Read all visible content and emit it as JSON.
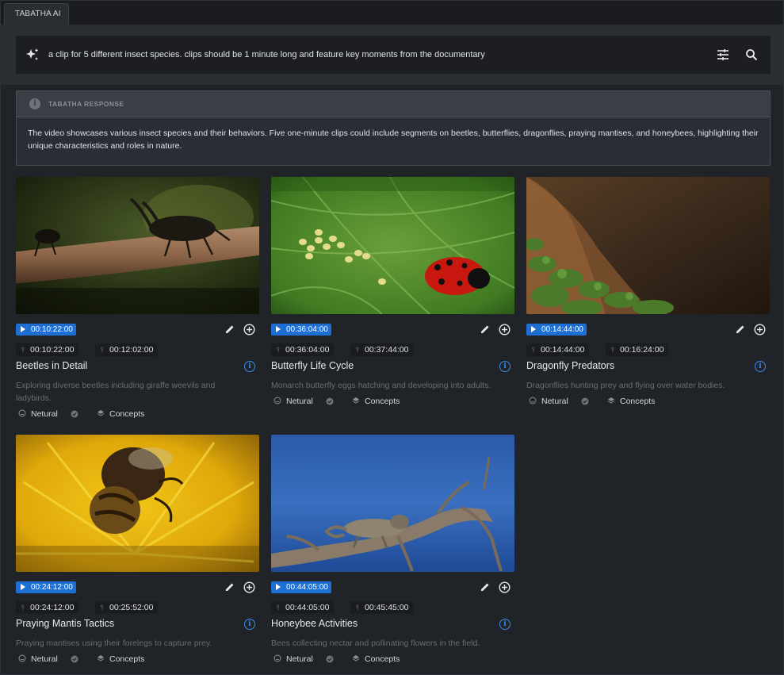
{
  "tab": {
    "label": "TABATHA AI"
  },
  "search": {
    "query": "a clip for 5 different insect species. clips should be 1 minute long and feature key moments from the documentary"
  },
  "response": {
    "title": "TABATHA RESPONSE",
    "body": "The video showcases various insect species and their behaviors. Five one-minute clips could include segments on beetles, butterflies, dragonflies, praying mantises, and honeybees, highlighting their unique characteristics and roles in nature."
  },
  "colors": {
    "accent": "#1e6fd4",
    "info": "#3b8be8",
    "background": "#202327"
  },
  "clips": [
    {
      "start": "00:10:22:00",
      "in": "00:10:22:00",
      "out": "00:12:02:00",
      "title": "Beetles in Detail",
      "description": "Exploring diverse beetles including giraffe weevils and ladybirds.",
      "tone": "Netural",
      "tag": "Concepts",
      "thumbnail": "beetles on a branch"
    },
    {
      "start": "00:36:04:00",
      "in": "00:36:04:00",
      "out": "00:37:44:00",
      "title": "Butterfly Life Cycle",
      "description": "Monarch butterfly eggs hatching and developing into adults.",
      "tone": "Netural",
      "tag": "Concepts",
      "thumbnail": "ladybird on a leaf with eggs"
    },
    {
      "start": "00:14:44:00",
      "in": "00:14:44:00",
      "out": "00:16:24:00",
      "title": "Dragonfly Predators",
      "description": "Dragonflies hunting prey and flying over water bodies.",
      "tone": "Netural",
      "tag": "Concepts",
      "thumbnail": "shore with plants"
    },
    {
      "start": "00:24:12:00",
      "in": "00:24:12:00",
      "out": "00:25:52:00",
      "title": "Praying Mantis Tactics",
      "description": "Praying mantises using their forelegs to capture prey.",
      "tone": "Netural",
      "tag": "Concepts",
      "thumbnail": "bee on yellow flower"
    },
    {
      "start": "00:44:05:00",
      "in": "00:44:05:00",
      "out": "00:45:45:00",
      "title": "Honeybee Activities",
      "description": "Bees collecting nectar and pollinating flowers in the field.",
      "tone": "Netural",
      "tag": "Concepts",
      "thumbnail": "chameleon on branch"
    }
  ]
}
